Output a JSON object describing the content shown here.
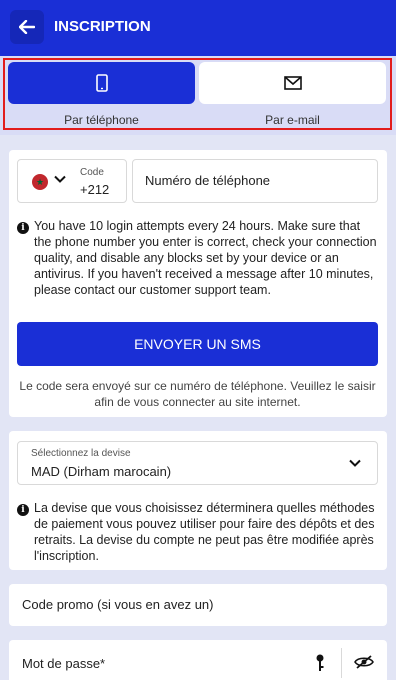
{
  "header": {
    "title": "INSCRIPTION",
    "back_icon": "arrow-left-icon"
  },
  "tabs": [
    {
      "label": "Par téléphone",
      "icon": "smartphone-icon",
      "active": true
    },
    {
      "label": "Par e-mail",
      "icon": "envelope-icon",
      "active": false
    }
  ],
  "phone": {
    "code_label": "Code",
    "code_value": "+212",
    "flag": "morocco-flag-icon",
    "placeholder": "Numéro de téléphone",
    "info": "You have 10 login attempts every 24 hours. Make sure that the phone number you enter is correct, check your connection quality, and disable any blocks set by your device or an antivirus. If you haven't received a message after 10 minutes, please contact our customer support team.",
    "sms_button": "ENVOYER UN SMS",
    "note": "Le code sera envoyé sur ce numéro de téléphone. Veuillez le saisir afin de vous connecter au site internet."
  },
  "currency": {
    "label": "Sélectionnez la devise",
    "value": "MAD  (Dirham marocain)",
    "info": "La devise que vous choisissez déterminera quelles méthodes de paiement vous pouvez utiliser pour faire des dépôts et des retraits. La devise du compte ne peut pas être modifiée après l'inscription."
  },
  "promo": {
    "placeholder": "Code promo (si vous en avez un)"
  },
  "password": {
    "placeholder": "Mot de passe*"
  },
  "colors": {
    "brand": "#1a2fd6",
    "highlight": "#e21c1c",
    "background": "#e2e5f5"
  }
}
